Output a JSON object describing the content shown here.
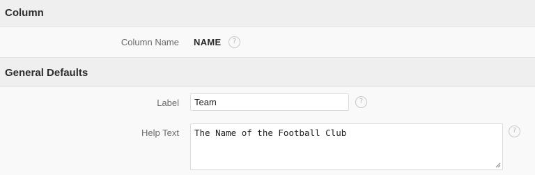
{
  "column_section": {
    "title": "Column",
    "column_name_label": "Column Name",
    "column_name_value": "NAME"
  },
  "general_defaults": {
    "title": "General Defaults",
    "label_field": {
      "label": "Label",
      "value": "Team"
    },
    "help_text_field": {
      "label": "Help Text",
      "value": "The Name of the Football Club"
    }
  },
  "help_icon_glyph": "?"
}
